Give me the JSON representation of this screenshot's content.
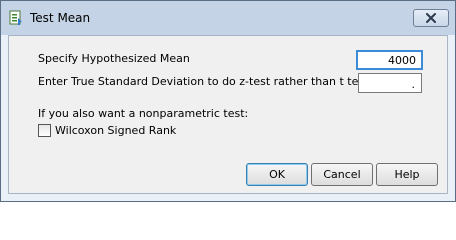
{
  "window": {
    "title": "Test Mean",
    "app_icon": "jmp-dialog-icon",
    "close_icon": "close-icon"
  },
  "form": {
    "hypothesized_mean_label": "Specify Hypothesized Mean",
    "hypothesized_mean_value": "4000",
    "true_sd_label": "Enter True Standard Deviation to do z-test rather than t test",
    "true_sd_value": ".",
    "nonparametric_label": "If you also want a nonparametric test:",
    "wilcoxon_label": "Wilcoxon Signed Rank",
    "wilcoxon_checked": false
  },
  "buttons": {
    "ok_label": "OK",
    "cancel_label": "Cancel",
    "help_label": "Help"
  },
  "colors": {
    "title_bar": "#c4d3e6",
    "client_bg": "#f0f0f0",
    "focus_border": "#3c8bd7",
    "default_button_border": "#3c7fb1"
  }
}
